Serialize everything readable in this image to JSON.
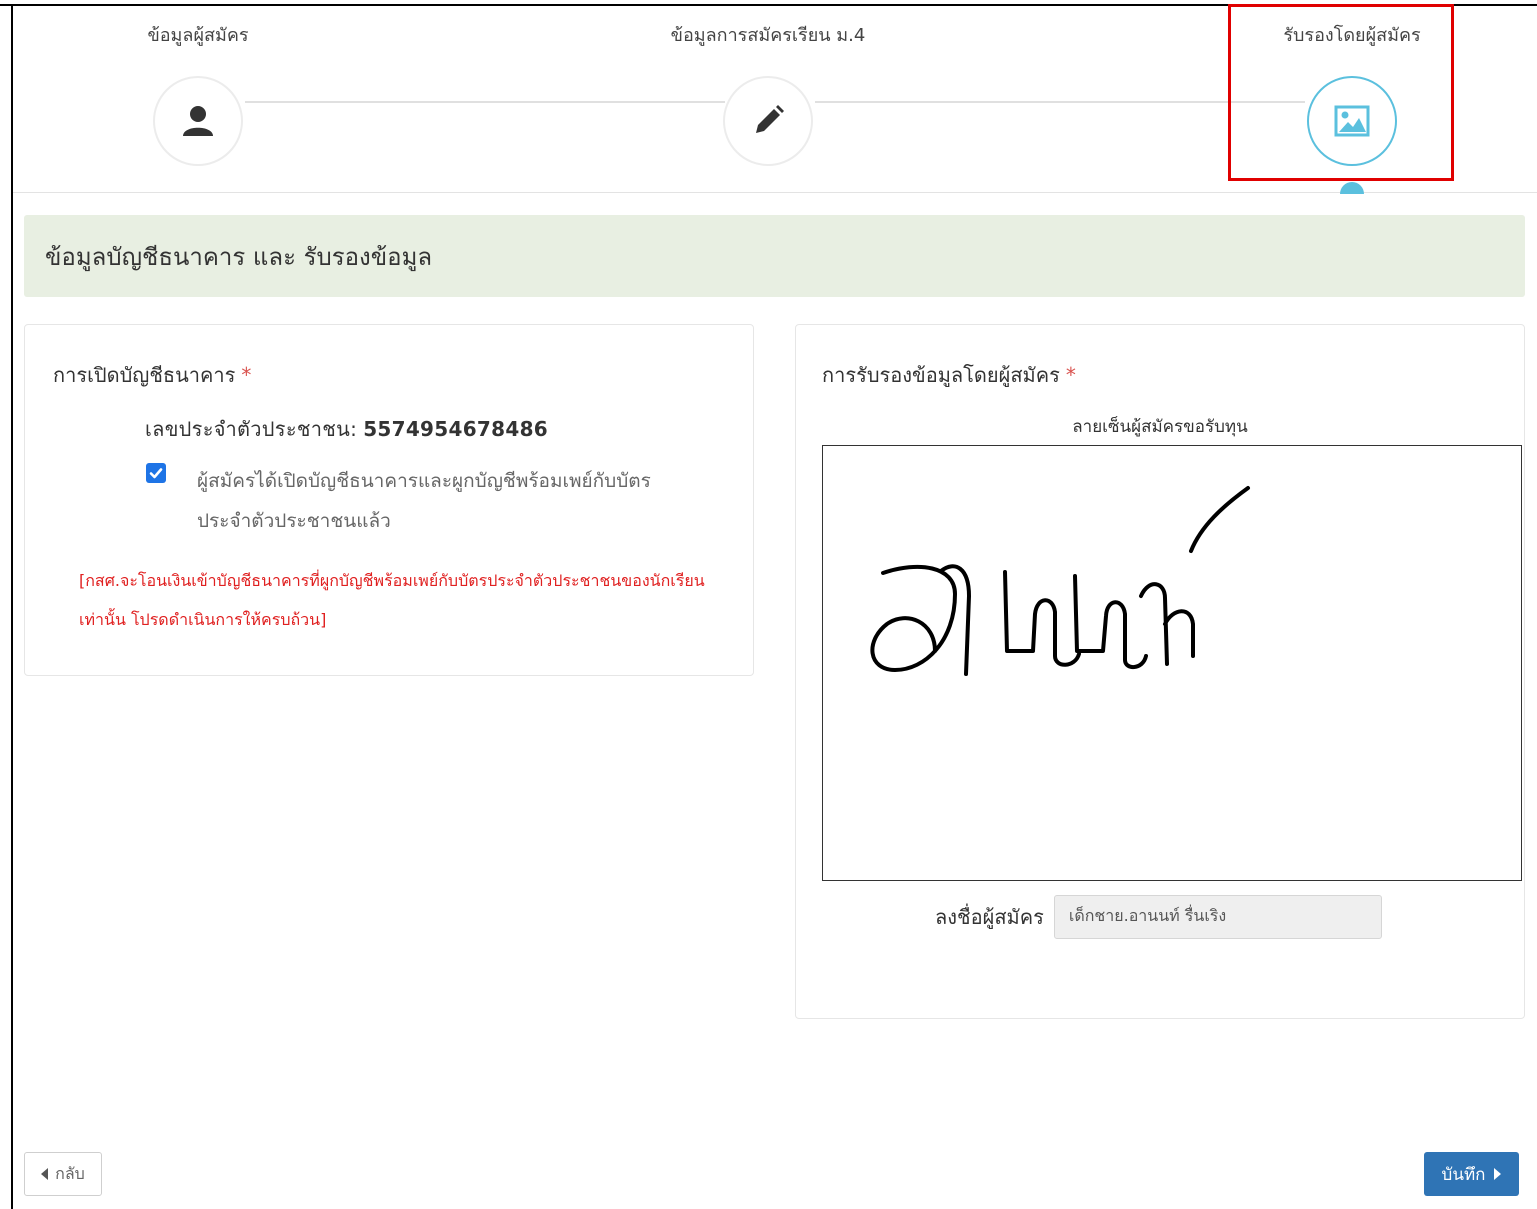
{
  "stepper": {
    "steps": [
      {
        "label": "ข้อมูลผู้สมัคร",
        "icon": "user-icon"
      },
      {
        "label": "ข้อมูลการสมัครเรียน ม.4",
        "icon": "pencil-icon"
      },
      {
        "label": "รับรองโดยผู้สมัคร",
        "icon": "image-icon"
      }
    ],
    "active_index": 2
  },
  "section": {
    "title": "ข้อมูลบัญชีธนาคาร และ รับรองข้อมูล"
  },
  "bank_card": {
    "title": "การเปิดบัญชีธนาคาร",
    "required_mark": "*",
    "citizen_id_label": "เลขประจำตัวประชาชน:",
    "citizen_id_value": "5574954678486",
    "checkbox_checked": true,
    "checkbox_label": "ผู้สมัครได้เปิดบัญชีธนาคารและผูกบัญชีพร้อมเพย์กับบัตรประจำตัวประชาชนแล้ว",
    "note": "[กสศ.จะโอนเงินเข้าบัญชีธนาคารที่ผูกบัญชีพร้อมเพย์กับบัตรประจำตัวประชาชนของนักเรียนเท่านั้น โปรดดำเนินการให้ครบถ้วน]"
  },
  "certify_card": {
    "title": "การรับรองข้อมูลโดยผู้สมัคร",
    "required_mark": "*",
    "signature_label": "ลายเซ็นผู้สมัครขอรับทุน",
    "signer_label": "ลงชื่อผู้สมัคร",
    "signer_value": "เด็กชาย.อานนท์ รื่นเริง"
  },
  "buttons": {
    "back_label": "กลับ",
    "save_label": "บันทึก"
  },
  "colors": {
    "accent": "#5bc0de",
    "primary": "#2f74b5",
    "checkbox": "#1e74e6",
    "note": "#e02020",
    "highlight": "#e00000",
    "section_bg": "#e8efe2"
  }
}
